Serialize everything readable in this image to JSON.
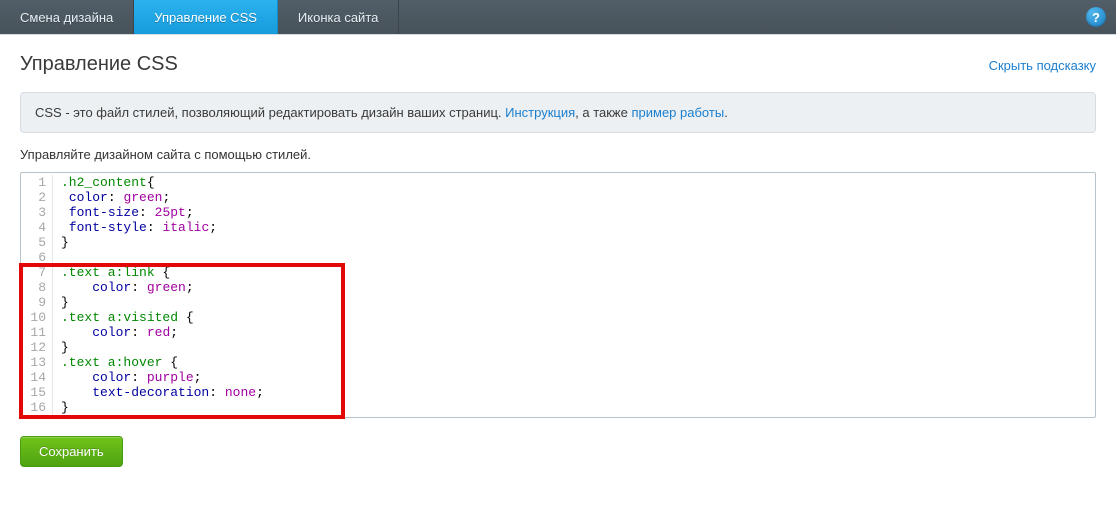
{
  "topbar": {
    "tabs": [
      {
        "label": "Смена дизайна"
      },
      {
        "label": "Управление CSS"
      },
      {
        "label": "Иконка сайта"
      }
    ],
    "help": "?"
  },
  "page": {
    "title": "Управление CSS",
    "hide_hint": "Скрыть подсказку"
  },
  "info": {
    "prefix": "CSS - это файл стилей, позволяющий редактировать дизайн ваших страниц. ",
    "link1": "Инструкция",
    "mid": ", а также ",
    "link2": "пример работы",
    "suffix": "."
  },
  "desc": "Управляйте дизайном сайта с помощью стилей.",
  "buttons": {
    "save": "Сохранить"
  },
  "code": {
    "lines": [
      {
        "n": "1",
        "tokens": [
          {
            "t": ".h2_content",
            "c": "sel"
          },
          {
            "t": "{",
            "c": "punct"
          }
        ]
      },
      {
        "n": "2",
        "tokens": [
          {
            "t": " ",
            "c": "punct"
          },
          {
            "t": "color",
            "c": "prop"
          },
          {
            "t": ": ",
            "c": "punct"
          },
          {
            "t": "green",
            "c": "val"
          },
          {
            "t": ";",
            "c": "punct"
          }
        ]
      },
      {
        "n": "3",
        "tokens": [
          {
            "t": " ",
            "c": "punct"
          },
          {
            "t": "font-size",
            "c": "prop"
          },
          {
            "t": ": ",
            "c": "punct"
          },
          {
            "t": "25pt",
            "c": "val"
          },
          {
            "t": ";",
            "c": "punct"
          }
        ]
      },
      {
        "n": "4",
        "tokens": [
          {
            "t": " ",
            "c": "punct"
          },
          {
            "t": "font-style",
            "c": "prop"
          },
          {
            "t": ": ",
            "c": "punct"
          },
          {
            "t": "italic",
            "c": "val"
          },
          {
            "t": ";",
            "c": "punct"
          }
        ]
      },
      {
        "n": "5",
        "tokens": [
          {
            "t": "}",
            "c": "punct"
          }
        ]
      },
      {
        "n": "6",
        "tokens": [
          {
            "t": "",
            "c": "punct"
          }
        ]
      },
      {
        "n": "7",
        "tokens": [
          {
            "t": ".text a:link",
            "c": "sel"
          },
          {
            "t": " {",
            "c": "punct"
          }
        ]
      },
      {
        "n": "8",
        "tokens": [
          {
            "t": "    ",
            "c": "punct"
          },
          {
            "t": "color",
            "c": "prop"
          },
          {
            "t": ": ",
            "c": "punct"
          },
          {
            "t": "green",
            "c": "val"
          },
          {
            "t": ";",
            "c": "punct"
          }
        ]
      },
      {
        "n": "9",
        "tokens": [
          {
            "t": "}",
            "c": "punct"
          }
        ]
      },
      {
        "n": "10",
        "tokens": [
          {
            "t": ".text a:visited",
            "c": "sel"
          },
          {
            "t": " {",
            "c": "punct"
          }
        ]
      },
      {
        "n": "11",
        "tokens": [
          {
            "t": "    ",
            "c": "punct"
          },
          {
            "t": "color",
            "c": "prop"
          },
          {
            "t": ": ",
            "c": "punct"
          },
          {
            "t": "red",
            "c": "val"
          },
          {
            "t": ";",
            "c": "punct"
          }
        ]
      },
      {
        "n": "12",
        "tokens": [
          {
            "t": "}",
            "c": "punct"
          }
        ]
      },
      {
        "n": "13",
        "tokens": [
          {
            "t": ".text a:hover",
            "c": "sel"
          },
          {
            "t": " {",
            "c": "punct"
          }
        ]
      },
      {
        "n": "14",
        "tokens": [
          {
            "t": "    ",
            "c": "punct"
          },
          {
            "t": "color",
            "c": "prop"
          },
          {
            "t": ": ",
            "c": "punct"
          },
          {
            "t": "purple",
            "c": "val"
          },
          {
            "t": ";",
            "c": "punct"
          }
        ]
      },
      {
        "n": "15",
        "tokens": [
          {
            "t": "    ",
            "c": "punct"
          },
          {
            "t": "text-decoration",
            "c": "prop"
          },
          {
            "t": ": ",
            "c": "punct"
          },
          {
            "t": "none",
            "c": "val"
          },
          {
            "t": ";",
            "c": "punct"
          }
        ]
      },
      {
        "n": "16",
        "tokens": [
          {
            "t": "}",
            "c": "punct"
          }
        ]
      }
    ]
  }
}
